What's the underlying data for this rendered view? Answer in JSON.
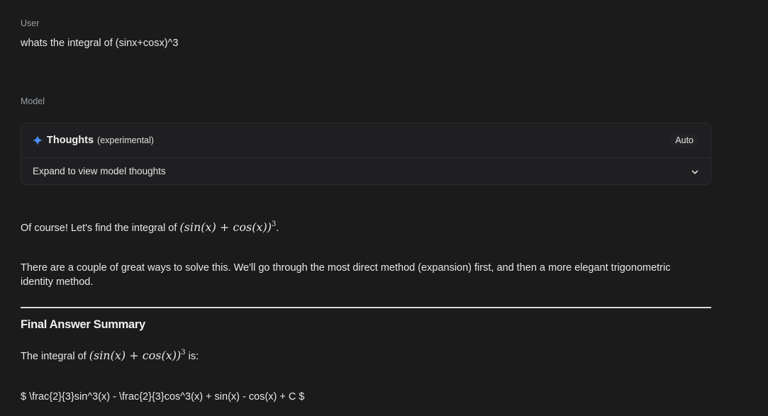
{
  "user": {
    "role_label": "User",
    "message": "whats the integral of (sinx+cosx)^3"
  },
  "model": {
    "role_label": "Model",
    "thoughts": {
      "icon": "sparkle-icon",
      "title": "Thoughts",
      "subtitle": "(experimental)",
      "mode_badge": "Auto",
      "expand_label": "Expand to view model thoughts",
      "expand_icon": "chevron-down-icon"
    },
    "response": {
      "intro_prefix": "Of course! Let's find the integral of ",
      "intro_math_base": "(sin(x) + cos(x))",
      "intro_math_exponent": "3",
      "intro_suffix": ".",
      "methods_text": "There are a couple of great ways to solve this. We'll go through the most direct method (expansion) first, and then a more elegant trigonometric identity method.",
      "summary_heading": "Final Answer Summary",
      "summary_prefix": "The integral of ",
      "summary_math_base": "(sin(x) + cos(x))",
      "summary_math_exponent": "3",
      "summary_suffix": " is:",
      "final_latex": "$ \\frac{2}{3}sin^3(x) - \\frac{2}{3}cos^3(x) + sin(x) - cos(x) + C $"
    }
  },
  "colors": {
    "background": "#1b1b1c",
    "panel": "#1f1f21",
    "sparkle_accent": "#4c8df6",
    "divider": "#d9d9d9"
  }
}
